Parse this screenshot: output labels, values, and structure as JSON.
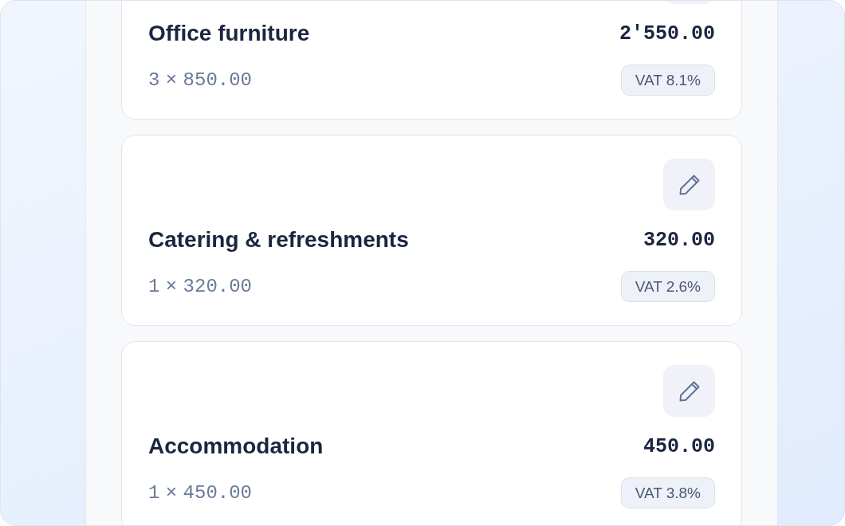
{
  "line_items": [
    {
      "name": "Office furniture",
      "amount": "2'550.00",
      "quantity_price": "3 × 850.00",
      "vat": "VAT 8.1%"
    },
    {
      "name": "Catering & refreshments",
      "amount": "320.00",
      "quantity_price": "1 × 320.00",
      "vat": "VAT 2.6%"
    },
    {
      "name": "Accommodation",
      "amount": "450.00",
      "quantity_price": "1 × 450.00",
      "vat": "VAT 3.8%"
    }
  ]
}
